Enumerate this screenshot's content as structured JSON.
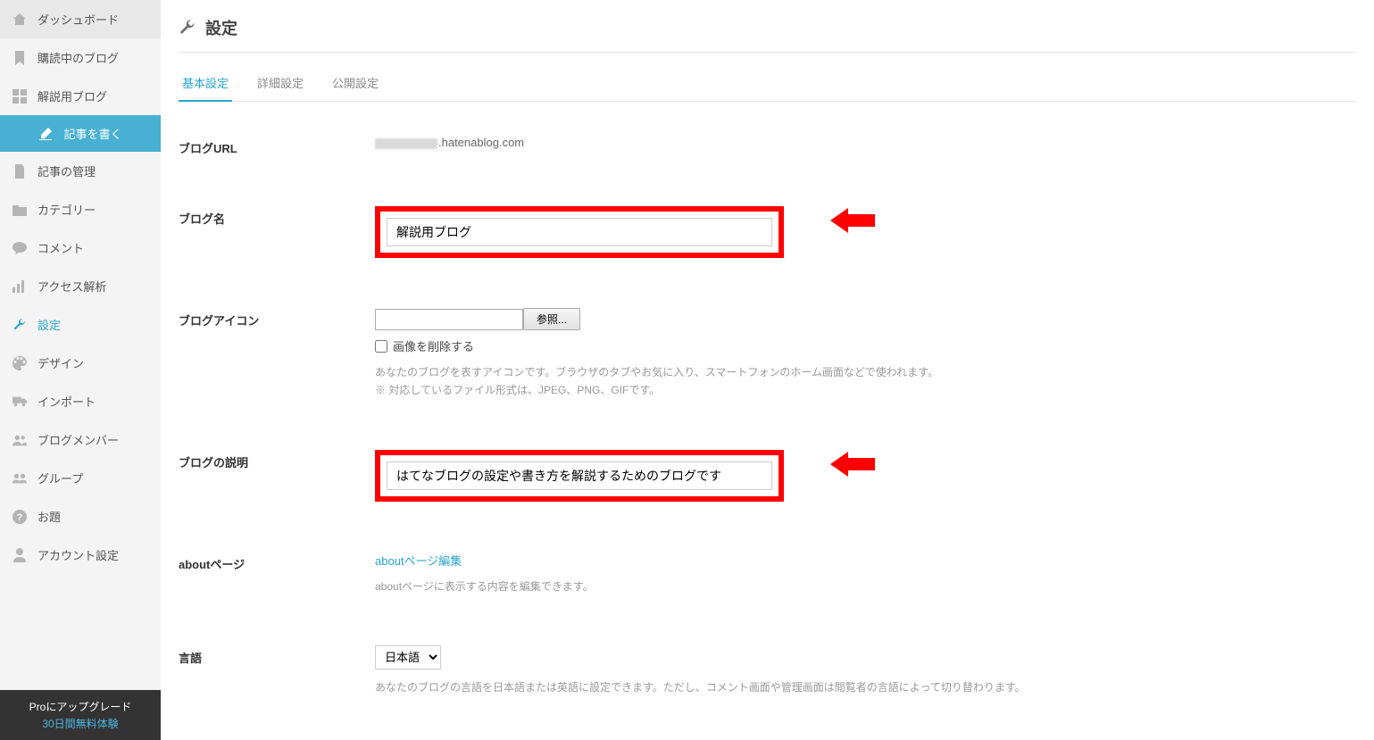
{
  "sidebar": {
    "items": [
      {
        "label": "ダッシュボード"
      },
      {
        "label": "購読中のブログ"
      },
      {
        "label": "解説用ブログ"
      },
      {
        "label": "記事を書く"
      },
      {
        "label": "記事の管理"
      },
      {
        "label": "カテゴリー"
      },
      {
        "label": "コメント"
      },
      {
        "label": "アクセス解析"
      },
      {
        "label": "設定"
      },
      {
        "label": "デザイン"
      },
      {
        "label": "インポート"
      },
      {
        "label": "ブログメンバー"
      },
      {
        "label": "グループ"
      },
      {
        "label": "お題"
      },
      {
        "label": "アカウント設定"
      }
    ],
    "upgrade_label": "Proにアップグレード",
    "trial_label": "30日間無料体験"
  },
  "page": {
    "title": "設定",
    "tabs": [
      {
        "label": "基本設定"
      },
      {
        "label": "詳細設定"
      },
      {
        "label": "公開設定"
      }
    ]
  },
  "fields": {
    "url": {
      "label": "ブログURL",
      "suffix": ".hatenablog.com"
    },
    "name": {
      "label": "ブログ名",
      "value": "解説用ブログ"
    },
    "icon": {
      "label": "ブログアイコン",
      "browse_btn": "参照...",
      "delete_chk": "画像を削除する",
      "help1": "あなたのブログを表すアイコンです。ブラウザのタブやお気に入り、スマートフォンのホーム画面などで使われます。",
      "help2": "※ 対応しているファイル形式は、JPEG、PNG、GIFです。"
    },
    "desc": {
      "label": "ブログの説明",
      "value": "はてなブログの設定や書き方を解説するためのブログです"
    },
    "about": {
      "label": "aboutページ",
      "link": "aboutページ編集",
      "help": "aboutページに表示する内容を編集できます。"
    },
    "lang": {
      "label": "言語",
      "value": "日本語",
      "help": "あなたのブログの言語を日本語または英語に設定できます。ただし、コメント画面や管理画面は閲覧者の言語によって切り替わります。"
    }
  }
}
